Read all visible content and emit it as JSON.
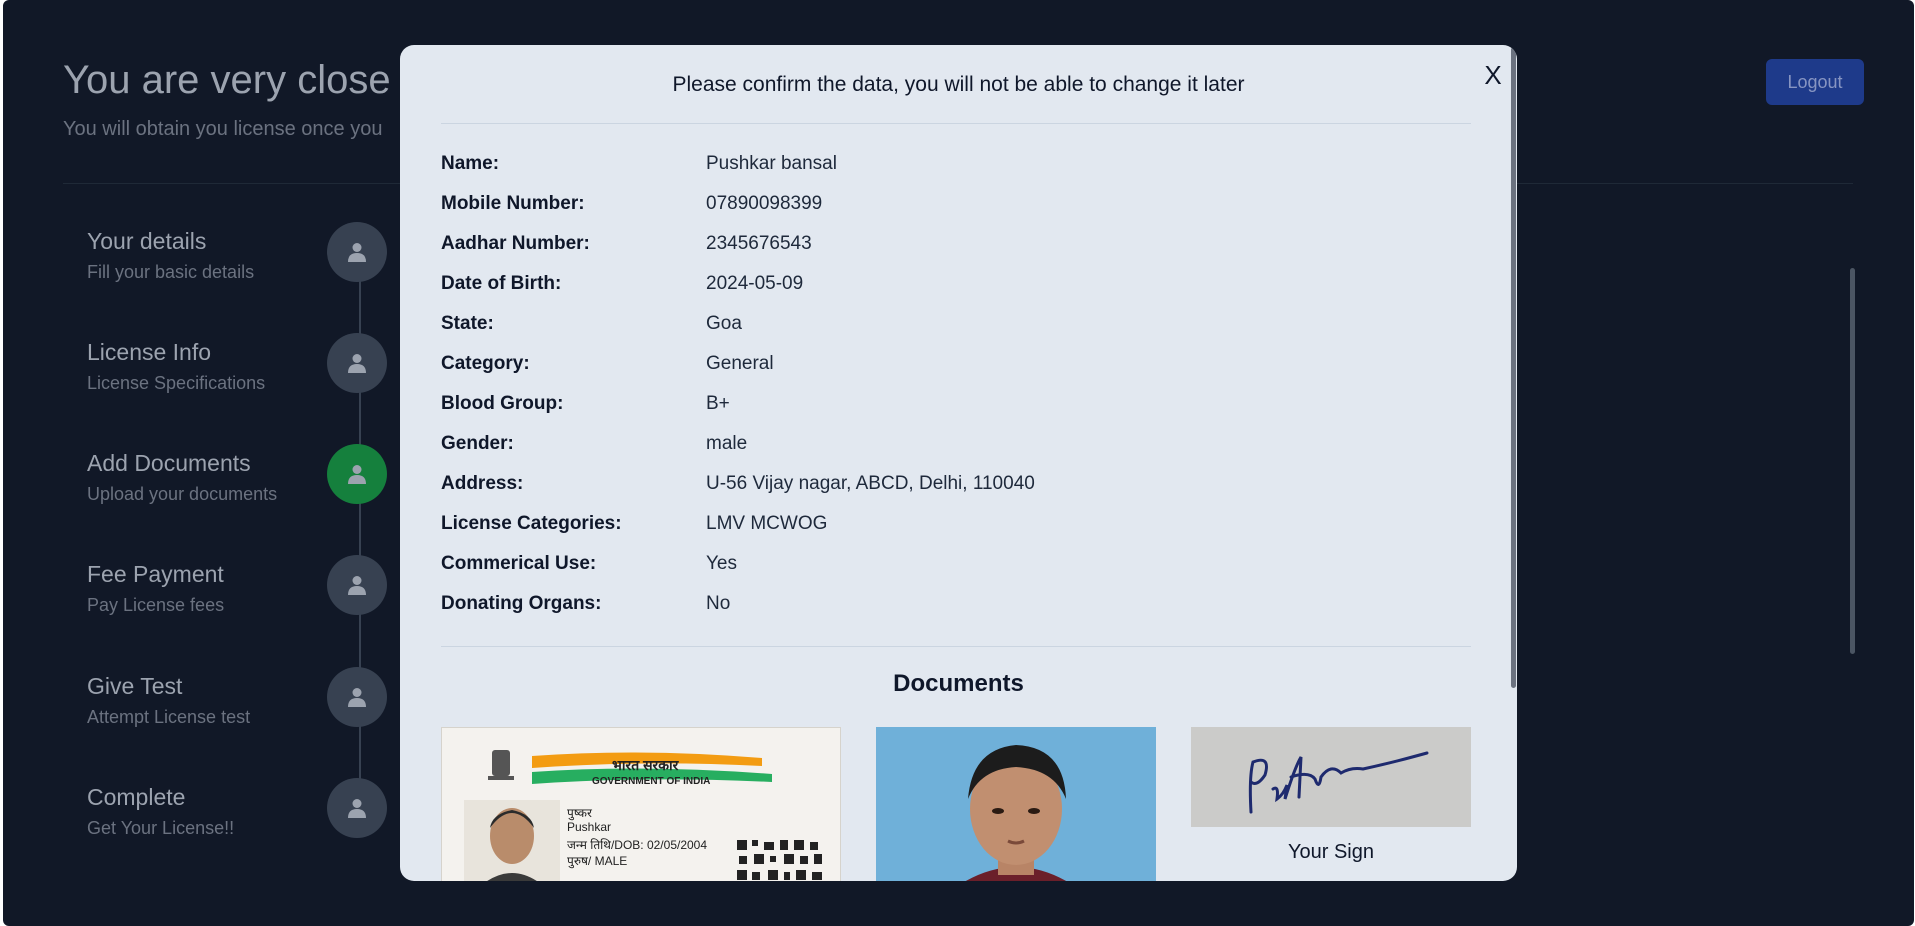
{
  "page": {
    "title": "You are very close",
    "subtitle": "You will obtain you license once you",
    "logout_label": "Logout"
  },
  "steps": [
    {
      "title": "Your details",
      "subtitle": "Fill your basic details",
      "active": false,
      "icon": "user-icon"
    },
    {
      "title": "License Info",
      "subtitle": "License Specifications",
      "active": false,
      "icon": "user-icon"
    },
    {
      "title": "Add Documents",
      "subtitle": "Upload your documents",
      "active": true,
      "icon": "user-icon"
    },
    {
      "title": "Fee Payment",
      "subtitle": "Pay License fees",
      "active": false,
      "icon": "user-icon"
    },
    {
      "title": "Give Test",
      "subtitle": "Attempt License test",
      "active": false,
      "icon": "user-icon"
    },
    {
      "title": "Complete",
      "subtitle": "Get Your License!!",
      "active": false,
      "icon": "user-icon"
    }
  ],
  "modal": {
    "heading": "Please confirm the data, you will not be able to change it later",
    "close_label": "X",
    "fields": [
      {
        "label": "Name:",
        "value": "Pushkar bansal"
      },
      {
        "label": "Mobile Number:",
        "value": "07890098399"
      },
      {
        "label": "Aadhar Number:",
        "value": "2345676543"
      },
      {
        "label": "Date of Birth:",
        "value": "2024-05-09"
      },
      {
        "label": "State:",
        "value": "Goa"
      },
      {
        "label": "Category:",
        "value": "General"
      },
      {
        "label": "Blood Group:",
        "value": "B+"
      },
      {
        "label": "Gender:",
        "value": "male"
      },
      {
        "label": "Address:",
        "value": "U-56 Vijay nagar, ABCD, Delhi, 110040"
      },
      {
        "label": "License Categories:",
        "value": "LMV MCWOG"
      },
      {
        "label": "Commerical Use:",
        "value": "Yes"
      },
      {
        "label": "Donating Organs:",
        "value": "No"
      }
    ],
    "documents_title": "Documents",
    "aadhar_card": {
      "header_hindi": "भारत सरकार",
      "header_english": "GOVERNMENT OF INDIA",
      "name_hindi": "पुष्कर",
      "name": "Pushkar",
      "dob": "जन्म तिथि/DOB: 02/05/2004",
      "gender": "पुरुष/ MALE"
    },
    "sign_caption": "Your Sign"
  },
  "colors": {
    "background": "#111827",
    "modal": "#e2e8f0",
    "active_step": "#15803d",
    "logout": "#1e3a8a"
  }
}
